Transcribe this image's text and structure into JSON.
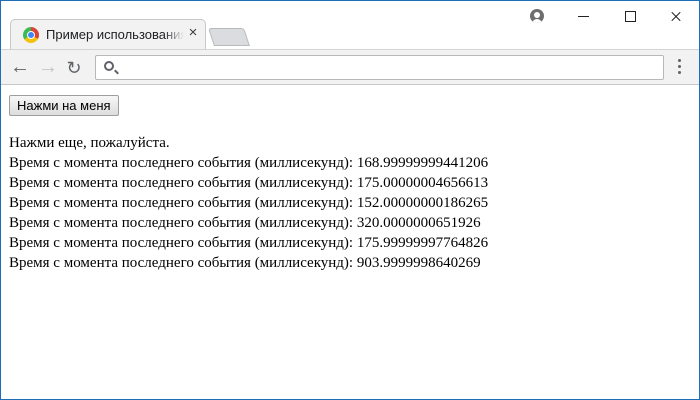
{
  "browser": {
    "tab_title": "Пример использования",
    "tab_close_symbol": "×",
    "address_value": "",
    "menu_symbol": "⋮"
  },
  "page": {
    "button_label": "Нажми на меня",
    "prompt": "Нажми еще, пожалуйста.",
    "event_lines": [
      "Время с момента последнего события (миллисекунд): 168.99999999441206",
      "Время с момента последнего события (миллисекунд): 175.00000004656613",
      "Время с момента последнего события (миллисекунд): 152.00000000186265",
      "Время с момента последнего события (миллисекунд): 320.0000000651926",
      "Время с момента последнего события (миллисекунд): 175.99999997764826",
      "Время с момента последнего события (миллисекунд): 903.9999998640269"
    ]
  }
}
